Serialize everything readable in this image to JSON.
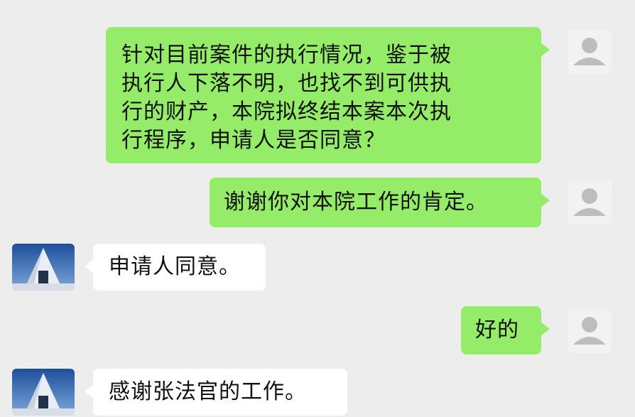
{
  "conversation": {
    "messages": [
      {
        "sender": "self",
        "lines": [
          "针对目前案件的执行情况，鉴于被",
          "执行人下落不明，也找不到可供执",
          "行的财产，本院拟终结本案本次执",
          "行程序，申请人是否同意？"
        ]
      },
      {
        "sender": "self",
        "lines": [
          "谢谢你对本院工作的肯定。"
        ]
      },
      {
        "sender": "other",
        "lines": [
          "申请人同意。"
        ]
      },
      {
        "sender": "self",
        "lines": [
          "好的"
        ]
      },
      {
        "sender": "other",
        "lines": [
          "感谢张法官的工作。"
        ]
      }
    ]
  },
  "colors": {
    "background": "#ededed",
    "self_bubble": "#95ec69",
    "other_bubble": "#ffffff"
  },
  "icons": {
    "self_avatar": "default-person-icon",
    "other_avatar": "building-photo-avatar"
  }
}
